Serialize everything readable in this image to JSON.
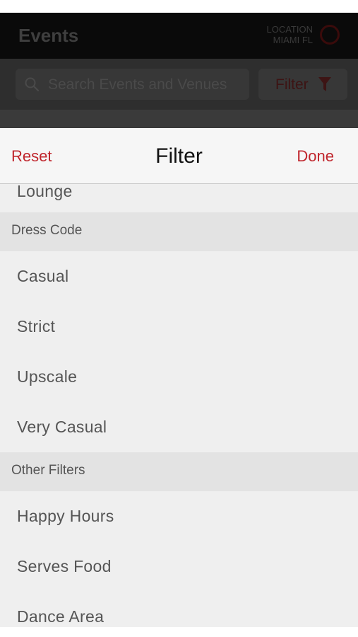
{
  "app": {
    "title": "Events",
    "location_label": "LOCATION",
    "location_value": "MIAMI FL",
    "search_placeholder": "Search Events and Venues",
    "filter_button_label": "Filter"
  },
  "sheet": {
    "reset_label": "Reset",
    "title": "Filter",
    "done_label": "Done"
  },
  "list": {
    "top_partial": "Lounge",
    "dress_code_header": "Dress Code",
    "dress_code_items": [
      "Casual",
      "Strict",
      "Upscale",
      "Very Casual"
    ],
    "other_header": "Other Filters",
    "other_items": [
      "Happy Hours",
      "Serves Food",
      "Dance Area"
    ]
  },
  "colors": {
    "accent": "#c0262d",
    "sheet_bg": "#efefef",
    "section_bg": "#e3e3e3"
  },
  "icons": [
    "search-icon",
    "filter-funnel-icon",
    "location-ring-icon"
  ]
}
